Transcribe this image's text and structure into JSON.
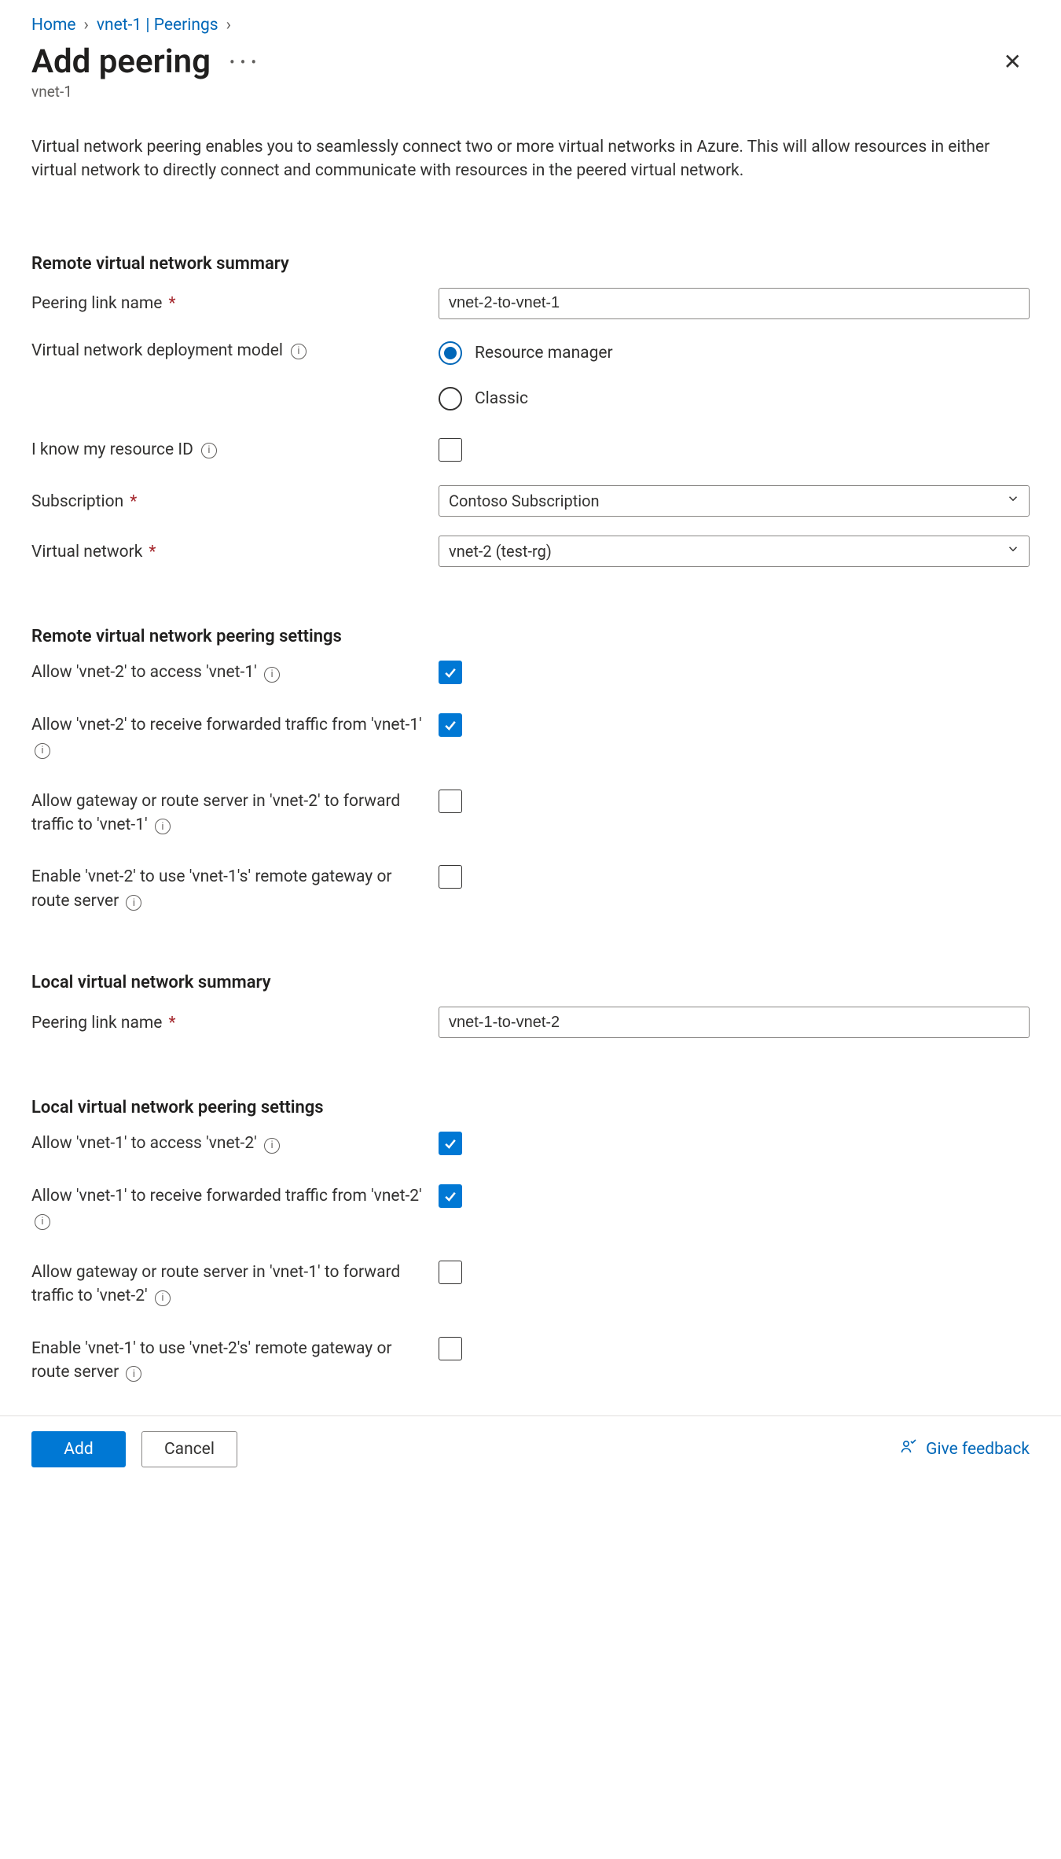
{
  "breadcrumb": {
    "home": "Home",
    "item2": "vnet-1 | Peerings"
  },
  "header": {
    "title": "Add peering",
    "subtitle": "vnet-1"
  },
  "description": "Virtual network peering enables you to seamlessly connect two or more virtual networks in Azure. This will allow resources in either virtual network to directly connect and communicate with resources in the peered virtual network.",
  "sections": {
    "remote_summary_heading": "Remote virtual network summary",
    "remote_settings_heading": "Remote virtual network peering settings",
    "local_summary_heading": "Local virtual network summary",
    "local_settings_heading": "Local virtual network peering settings"
  },
  "fields": {
    "peering_link_name_label": "Peering link name",
    "peering_link_name_value_remote": "vnet-2-to-vnet-1",
    "peering_link_name_value_local": "vnet-1-to-vnet-2",
    "deployment_model_label": "Virtual network deployment model",
    "deployment_model_options": {
      "resource_manager": "Resource manager",
      "classic": "Classic"
    },
    "know_resource_id_label": "I know my resource ID",
    "subscription_label": "Subscription",
    "subscription_value": "Contoso Subscription",
    "virtual_network_label": "Virtual network",
    "virtual_network_value": "vnet-2 (test-rg)"
  },
  "remote_settings": {
    "allow_access": "Allow 'vnet-2' to access 'vnet-1'",
    "allow_forwarded": "Allow 'vnet-2' to receive forwarded traffic from 'vnet-1'",
    "allow_gateway": "Allow gateway or route server in 'vnet-2' to forward traffic to 'vnet-1'",
    "enable_remote_gateway": "Enable 'vnet-2' to use 'vnet-1's' remote gateway or route server"
  },
  "local_settings": {
    "allow_access": "Allow 'vnet-1' to access 'vnet-2'",
    "allow_forwarded": "Allow 'vnet-1' to receive forwarded traffic from 'vnet-2'",
    "allow_gateway": "Allow gateway or route server in 'vnet-1' to forward traffic to 'vnet-2'",
    "enable_remote_gateway": "Enable 'vnet-1' to use 'vnet-2's' remote gateway or route server"
  },
  "footer": {
    "add": "Add",
    "cancel": "Cancel",
    "feedback": "Give feedback"
  }
}
